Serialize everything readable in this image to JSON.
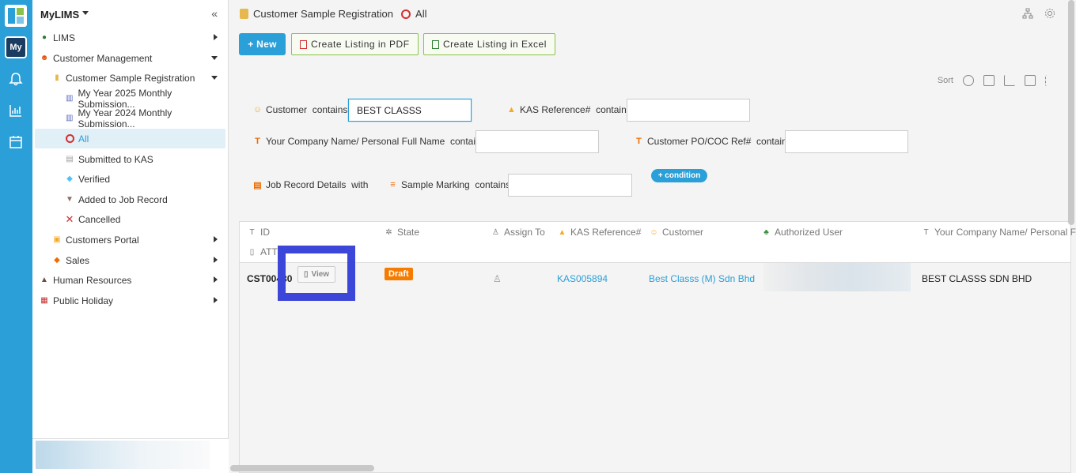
{
  "app": {
    "title": "MyLIMS",
    "rail_badge": "My"
  },
  "sidebar": {
    "items": [
      {
        "label": "LIMS",
        "icon": "globe-icon"
      },
      {
        "label": "Customer Management",
        "icon": "face-icon"
      },
      {
        "label": "Customer Sample Registration",
        "icon": "scroll-icon"
      },
      {
        "label": "My Year 2025 Monthly Submission...",
        "icon": "chart-icon"
      },
      {
        "label": "My Year 2024 Monthly Submission...",
        "icon": "chart-icon"
      },
      {
        "label": "All",
        "icon": "ring-icon"
      },
      {
        "label": "Submitted to KAS",
        "icon": "doc-icon"
      },
      {
        "label": "Verified",
        "icon": "diamond-icon"
      },
      {
        "label": "Added to Job Record",
        "icon": "inbox-icon"
      },
      {
        "label": "Cancelled",
        "icon": "x-icon"
      },
      {
        "label": "Customers Portal",
        "icon": "people-icon"
      },
      {
        "label": "Sales",
        "icon": "diamond-orange-icon"
      },
      {
        "label": "Human Resources",
        "icon": "image-icon"
      },
      {
        "label": "Public Holiday",
        "icon": "calendar-icon"
      }
    ]
  },
  "header": {
    "breadcrumb": "Customer Sample Registration",
    "view_name": "All"
  },
  "actions": {
    "new_label": "+ New",
    "pdf_label": "Create Listing in PDF",
    "excel_label": "Create Listing in Excel"
  },
  "toolbar": {
    "sort_label": "Sort"
  },
  "filters": {
    "customer_label": "Customer",
    "customer_op": "contains",
    "customer_value": "BEST CLASSS",
    "kas_label": "KAS Reference#",
    "kas_op": "contains",
    "kas_value": "",
    "company_label": "Your Company Name/ Personal Full Name",
    "company_op": "contains",
    "company_value": "",
    "po_label": "Customer PO/COC Ref#",
    "po_op": "contains",
    "po_value": "",
    "job_label": "Job Record Details",
    "job_op": "with",
    "marking_label": "Sample Marking",
    "marking_op": "contains",
    "marking_value": "",
    "condition_label": "+ condition"
  },
  "table": {
    "headers": {
      "id": "ID",
      "state": "State",
      "assign": "Assign To",
      "kas": "KAS Reference#",
      "customer": "Customer",
      "auth": "Authorized User",
      "company": "Your Company Name/ Personal F",
      "att": "ATT"
    },
    "rows": [
      {
        "id": "CST00480",
        "view_label": "View",
        "state": "Draft",
        "kas": "KAS005894",
        "customer": "Best Classs (M) Sdn Bhd",
        "company": "BEST CLASSS SDN BHD"
      }
    ]
  },
  "colors": {
    "accent": "#2a9fd8",
    "draft": "#f57c00",
    "highlight": "#3c46d8"
  }
}
